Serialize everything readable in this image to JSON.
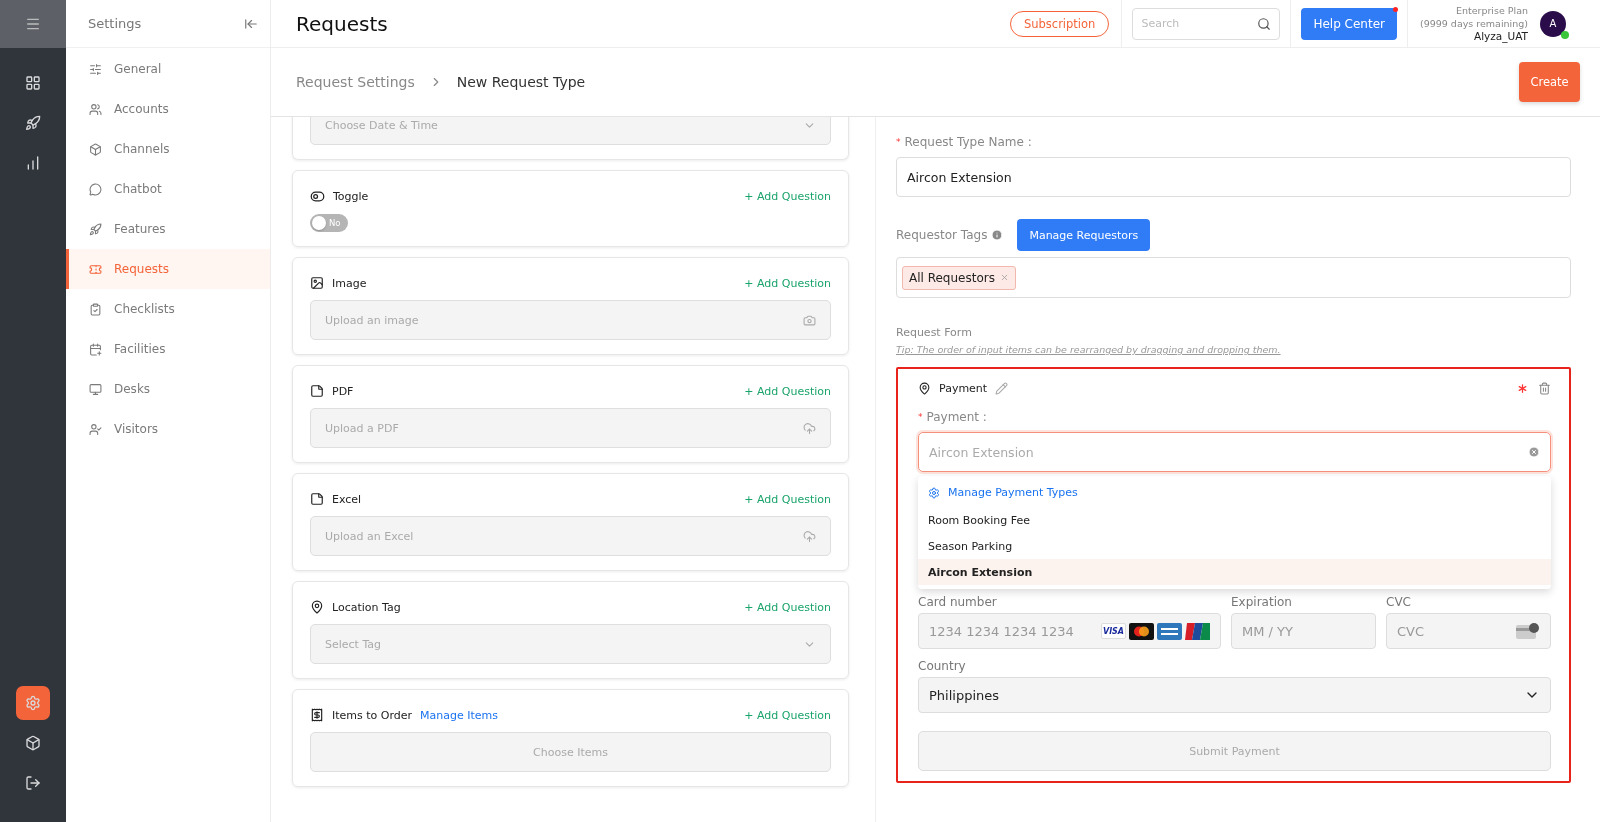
{
  "rail": {
    "top": [
      {
        "selected": false
      },
      {
        "selected": false
      },
      {
        "selected": false
      }
    ],
    "bottom": [
      {
        "selected": true
      },
      {
        "selected": false
      },
      {
        "selected": false
      }
    ]
  },
  "sidebar": {
    "title": "Settings",
    "items": [
      {
        "label": "General",
        "selected": false
      },
      {
        "label": "Accounts",
        "selected": false
      },
      {
        "label": "Channels",
        "selected": false
      },
      {
        "label": "Chatbot",
        "selected": false
      },
      {
        "label": "Features",
        "selected": false
      },
      {
        "label": "Requests",
        "selected": true
      },
      {
        "label": "Checklists",
        "selected": false
      },
      {
        "label": "Facilities",
        "selected": false
      },
      {
        "label": "Desks",
        "selected": false
      },
      {
        "label": "Visitors",
        "selected": false
      }
    ]
  },
  "header": {
    "title": "Requests",
    "subscription": "Subscription",
    "search": {
      "placeholder": "Search"
    },
    "help_center": "Help Center",
    "plan": "Enterprise Plan",
    "days": "(9999 days remaining)",
    "user": "Alyza_UAT",
    "avatar": "A",
    "online": true
  },
  "breadcrumb": [
    "Request Settings",
    "New Request Type"
  ],
  "create": "Create",
  "question_types": [
    {
      "kind": "datetime",
      "placeholder": "Choose Date & Time"
    },
    {
      "kind": "toggle",
      "label": "Toggle",
      "action": "+ Add Question",
      "toggle": {
        "on": false,
        "label": "No"
      }
    },
    {
      "kind": "image",
      "label": "Image",
      "action": "+ Add Question",
      "placeholder": "Upload an image"
    },
    {
      "kind": "pdf",
      "label": "PDF",
      "action": "+ Add Question",
      "placeholder": "Upload a PDF"
    },
    {
      "kind": "excel",
      "label": "Excel",
      "action": "+ Add Question",
      "placeholder": "Upload an Excel"
    },
    {
      "kind": "location",
      "label": "Location Tag",
      "action": "+ Add Question",
      "placeholder": "Select Tag"
    },
    {
      "kind": "items",
      "label": "Items to Order",
      "link": "Manage Items",
      "action": "+ Add Question",
      "placeholder": "Choose Items"
    }
  ],
  "form": {
    "required_mark": "*",
    "name_label": "Request Type Name :",
    "name_value": "Aircon Extension",
    "tags_label": "Requestor Tags",
    "manage_requestors": "Manage Requestors",
    "tags": [
      {
        "label": "All Requestors"
      }
    ],
    "form_label": "Request Form",
    "tip": "Tip: The order of input items can be rearranged by dragging and dropping them.",
    "payment": {
      "title": "Payment",
      "required_mark": "*",
      "field_label": "Payment :",
      "field_value": "Aircon Extension",
      "manage": "Manage Payment Types",
      "options": [
        {
          "label": "Room Booking Fee",
          "selected": false
        },
        {
          "label": "Season Parking",
          "selected": false
        },
        {
          "label": "Aircon Extension",
          "selected": true
        }
      ],
      "card_label": "Card number",
      "card_placeholder": "1234 1234 1234 1234",
      "visa": "VISA",
      "exp_label": "Expiration",
      "exp_placeholder": "MM / YY",
      "cvc_label": "CVC",
      "cvc_placeholder": "CVC",
      "country_label": "Country",
      "country_value": "Philippines",
      "submit": "Submit Payment"
    }
  }
}
